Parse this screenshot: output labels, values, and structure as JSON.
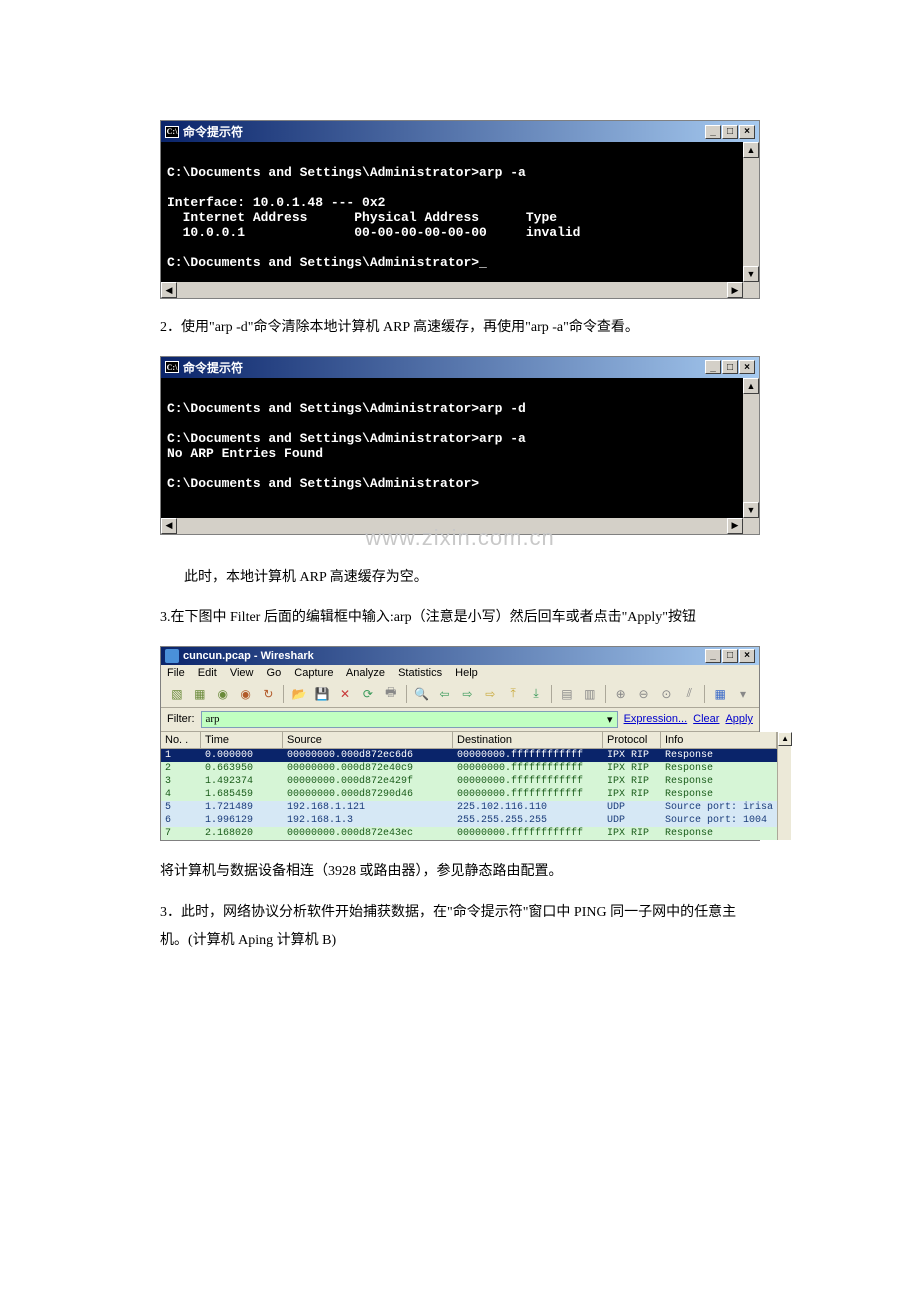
{
  "cmd1": {
    "title": "命令提示符",
    "icon_text": "C:\\",
    "body": "\nC:\\Documents and Settings\\Administrator>arp -a\n\nInterface: 10.0.1.48 --- 0x2\n  Internet Address      Physical Address      Type\n  10.0.0.1              00-00-00-00-00-00     invalid\n\nC:\\Documents and Settings\\Administrator>_"
  },
  "para2": "2．使用\"arp -d\"命令清除本地计算机 ARP 高速缓存，再使用\"arp -a\"命令查看。",
  "cmd2": {
    "title": "命令提示符",
    "icon_text": "C:\\",
    "body": "\nC:\\Documents and Settings\\Administrator>arp -d\n\nC:\\Documents and Settings\\Administrator>arp -a\nNo ARP Entries Found\n\nC:\\Documents and Settings\\Administrator>\n"
  },
  "watermark": "www.zixin.com.cn",
  "para2b": "此时，本地计算机 ARP 高速缓存为空。",
  "para3": "3.在下图中 Filter 后面的编辑框中输入:arp（注意是小写）然后回车或者点击\"Apply\"按钮",
  "ws": {
    "title": "cuncun.pcap - Wireshark",
    "menus": [
      "File",
      "Edit",
      "View",
      "Go",
      "Capture",
      "Analyze",
      "Statistics",
      "Help"
    ],
    "filter_label": "Filter:",
    "filter_value": "arp",
    "filter_links": [
      "Expression...",
      "Clear",
      "Apply"
    ],
    "columns": [
      "No. .",
      "Time",
      "Source",
      "Destination",
      "Protocol",
      "Info"
    ],
    "rows": [
      {
        "no": "1",
        "time": "0.000000",
        "src": "00000000.000d872ec6d6",
        "dst": "00000000.ffffffffffff",
        "proto": "IPX RIP",
        "info": "Response",
        "cls": "sel"
      },
      {
        "no": "2",
        "time": "0.663950",
        "src": "00000000.000d872e40c9",
        "dst": "00000000.ffffffffffff",
        "proto": "IPX RIP",
        "info": "Response",
        "cls": "green"
      },
      {
        "no": "3",
        "time": "1.492374",
        "src": "00000000.000d872e429f",
        "dst": "00000000.ffffffffffff",
        "proto": "IPX RIP",
        "info": "Response",
        "cls": "green"
      },
      {
        "no": "4",
        "time": "1.685459",
        "src": "00000000.000d87290d46",
        "dst": "00000000.ffffffffffff",
        "proto": "IPX RIP",
        "info": "Response",
        "cls": "green"
      },
      {
        "no": "5",
        "time": "1.721489",
        "src": "192.168.1.121",
        "dst": "225.102.116.110",
        "proto": "UDP",
        "info": "Source port: irisa",
        "cls": "blue"
      },
      {
        "no": "6",
        "time": "1.996129",
        "src": "192.168.1.3",
        "dst": "255.255.255.255",
        "proto": "UDP",
        "info": "Source port: 1004",
        "cls": "blue"
      },
      {
        "no": "7",
        "time": "2.168020",
        "src": "00000000.000d872e43ec",
        "dst": "00000000.ffffffffffff",
        "proto": "IPX RIP",
        "info": "Response",
        "cls": "green"
      }
    ]
  },
  "para4": "将计算机与数据设备相连（3928 或路由器），参见静态路由配置。",
  "para5": "3．此时，网络协议分析软件开始捕获数据，在\"命令提示符\"窗口中 PING 同一子网中的任意主机。(计算机 Aping 计算机 B)"
}
